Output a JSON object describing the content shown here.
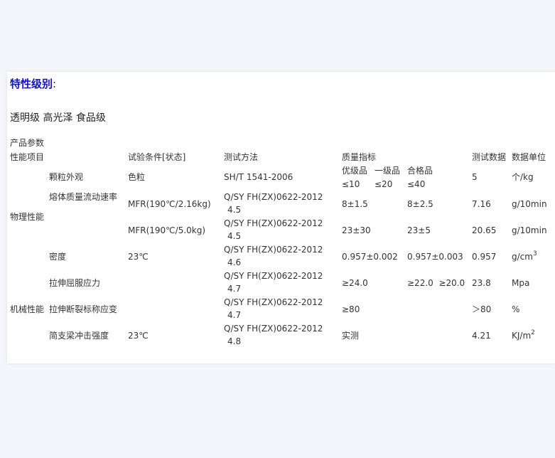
{
  "heading": "特性级别",
  "heading_colon": ":",
  "levels": "透明级 高光泽 食品级",
  "header": {
    "product_params": "产品参数",
    "performance_item": "性能项目",
    "test_condition": "试验条件[状态]",
    "test_method": "测试方法",
    "quality_index": "质量指标",
    "test_data": "测试数据",
    "data_unit": "数据单位"
  },
  "groups": {
    "physical": "物理性能",
    "mechanical": "机械性能"
  },
  "rows": {
    "particle": {
      "item": "颗粒外观",
      "condition": "色粒",
      "method": "SH/T 1541-2006",
      "grade1_label": "优级品",
      "grade2_label": "一级品",
      "grade3_label": "合格品",
      "grade1": "≤10",
      "grade2": "≤20",
      "grade3": "≤40",
      "data": "5",
      "unit": "个/kg"
    },
    "mfr1": {
      "item": "熔体质量流动速率",
      "condition": "MFR(190℃/2.16kg)",
      "method1": "Q/SY FH(ZX)0622-2012",
      "method2": "4.5",
      "q1": "8±1.5",
      "q3": "8±2.5",
      "data": "7.16",
      "unit": "g/10min"
    },
    "mfr2": {
      "condition": "MFR(190℃/5.0kg)",
      "method1": "Q/SY FH(ZX)0622-2012",
      "method2": "4.5",
      "q1": "23±30",
      "q3": "23±5",
      "data": "20.65",
      "unit": "g/10min"
    },
    "density": {
      "item": "密度",
      "condition": "23℃",
      "method1": "Q/SY FH(ZX)0622-2012",
      "method2": "4.6",
      "q1": "0.957±0.002",
      "q3": "0.957±0.003",
      "data": "0.957",
      "unit_base": "g/cm",
      "unit_sup": "3"
    },
    "yield": {
      "item": "拉伸屈服应力",
      "method1": "Q/SY FH(ZX)0622-2012",
      "method2": "4.7",
      "q1": "≥24.0",
      "q3": "≥22.0  ≥20.0",
      "data": "23.8",
      "unit": "Mpa"
    },
    "elong": {
      "item": "拉伸断裂标称应变",
      "method1": "Q/SY FH(ZX)0622-2012",
      "method2": "4.7",
      "q1": "≥80",
      "data": "＞80",
      "unit": "%"
    },
    "impact": {
      "item": "简支梁冲击强度",
      "condition": "23℃",
      "method1": "Q/SY FH(ZX)0622-2012",
      "method2": "4.8",
      "q1": "实测",
      "data": "4.21",
      "unit_base": "KJ/m",
      "unit_sup": "2"
    }
  }
}
